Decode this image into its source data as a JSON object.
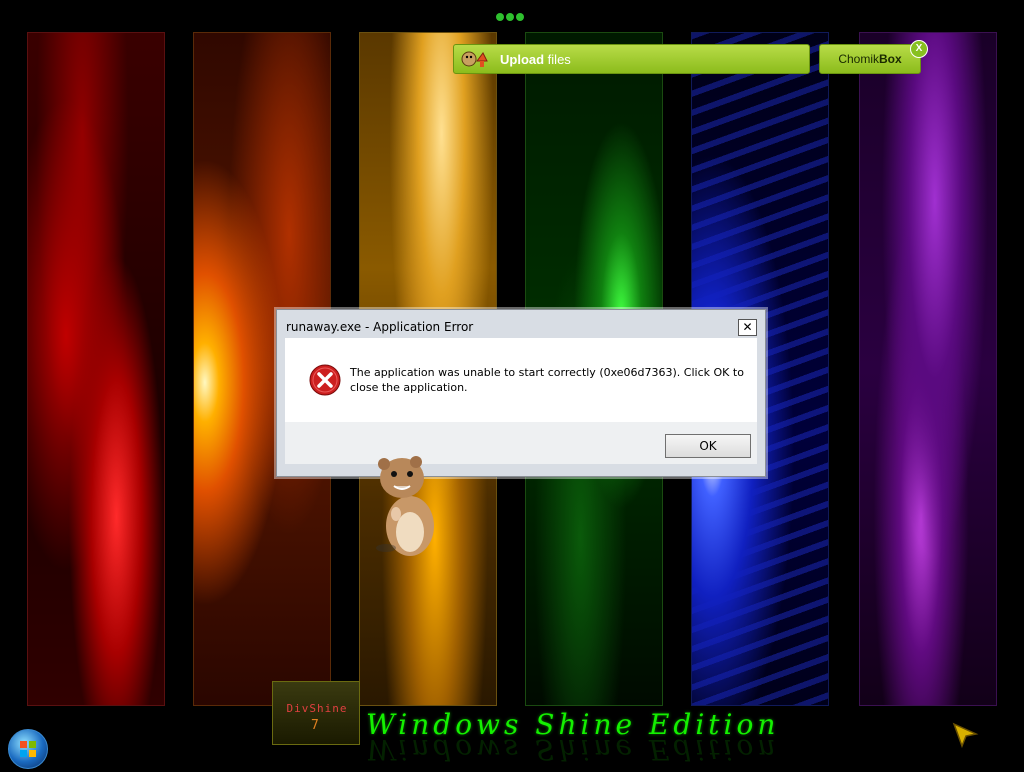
{
  "toolbar": {
    "upload_label_bold": "Upload",
    "upload_label_rest": " files",
    "chomik_label_regular": "Chomik",
    "chomik_label_bold": "Box",
    "chomik_close": "X"
  },
  "dialog": {
    "title": "runaway.exe - Application Error",
    "close_glyph": "✕",
    "message": "The application was unable to start correctly (0xe06d7363). Click OK to close the application.",
    "ok_label": "OK"
  },
  "desktop": {
    "logo_text": "DivShine",
    "logo_number": "7",
    "edition_text": "Windows Shine Edition"
  },
  "icons": {
    "upload": "upload-icon",
    "error": "error-icon",
    "start": "windows-start-icon",
    "cursor": "pointer-cursor"
  },
  "colors": {
    "accent_green": "#8cbc1c",
    "edition_green": "#14f000",
    "error_red": "#cc1f1f"
  }
}
